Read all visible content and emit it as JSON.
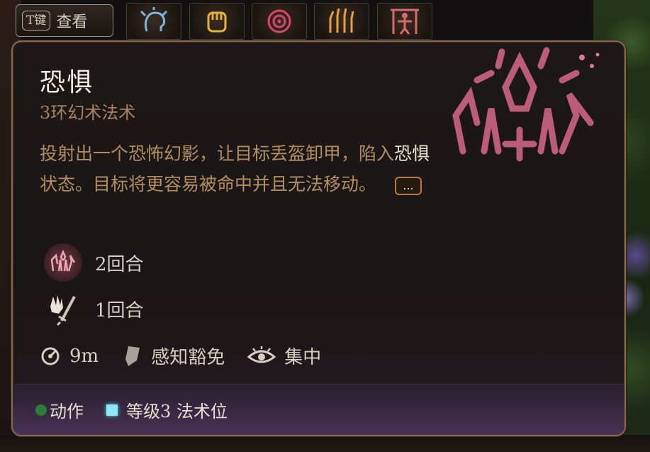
{
  "action_bar": {
    "peek_key": "T键",
    "peek_label": "查看",
    "slots": [
      {
        "icon": "mind-head-icon",
        "color": "#7ab8d8"
      },
      {
        "icon": "fist-icon",
        "color": "#e6b33a"
      },
      {
        "icon": "spiral-icon",
        "color": "#d8476b"
      },
      {
        "icon": "flame-hands-icon",
        "color": "#e8a23a"
      },
      {
        "icon": "bound-figure-icon",
        "color": "#d86a6a"
      }
    ]
  },
  "tooltip": {
    "title": "恐惧",
    "subtitle": "3环幻术法术",
    "description": {
      "part1": "投射出一个恐怖幻影，让目标丢盔卸甲，陷入",
      "keyword": "恐惧",
      "part2": "状态。目标将更容易被命中并且无法移动。",
      "more_label": "..."
    },
    "effects": [
      {
        "icon": "fear-condition-icon",
        "duration": "2回合"
      },
      {
        "icon": "drop-weapon-icon",
        "duration": "1回合"
      }
    ],
    "stats": {
      "range": "9m",
      "save": "感知豁免",
      "concentration": "集中"
    },
    "footer": {
      "action_label": "动作",
      "slot_label": "等级3 法术位"
    }
  },
  "colors": {
    "title": "#f2ebe2",
    "subtitle": "#a7835f",
    "description": "#b38d62",
    "border": "#8d6a45",
    "emblem": "#d86a8a"
  }
}
